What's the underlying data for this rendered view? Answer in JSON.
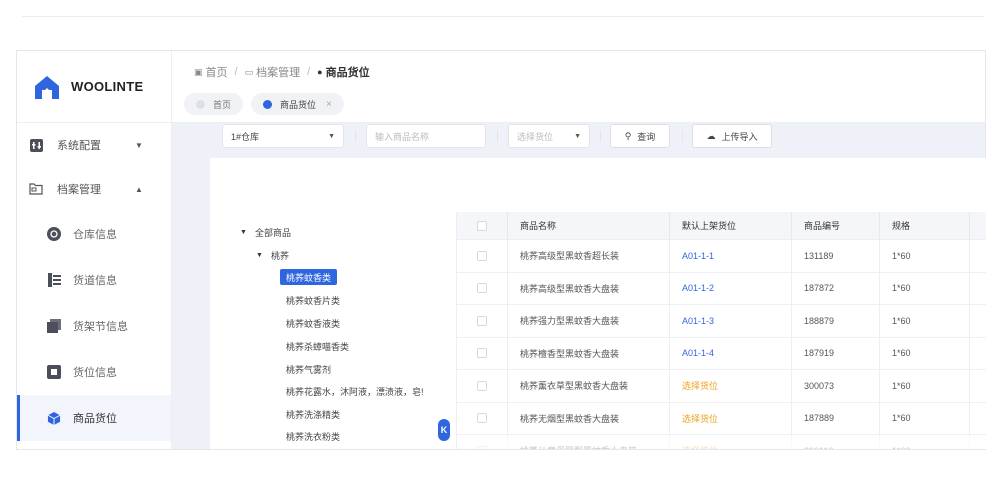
{
  "app": {
    "logo_text": "WOOLINTE",
    "brand_color": "#2f66e0",
    "warn_color": "#f0a020"
  },
  "sidebar": {
    "groups": [
      {
        "label": "系统配置",
        "icon": "settings-sliders-icon",
        "caret": "▼"
      },
      {
        "label": "档案管理",
        "icon": "folder-icon",
        "caret": "▲"
      }
    ],
    "items": [
      {
        "label": "仓库信息",
        "icon": "warehouse-icon"
      },
      {
        "label": "货道信息",
        "icon": "aisle-icon"
      },
      {
        "label": "货架节信息",
        "icon": "shelf-section-icon"
      },
      {
        "label": "货位信息",
        "icon": "slot-icon"
      },
      {
        "label": "商品货位",
        "icon": "cube-icon"
      }
    ]
  },
  "header": {
    "breadcrumb": [
      "首页",
      "档案管理",
      "商品货位"
    ],
    "tabs": [
      {
        "label": "首页"
      },
      {
        "label": "商品货位",
        "close": "×"
      }
    ]
  },
  "toolbar": {
    "warehouse_select": "1#仓库",
    "name_placeholder": "输入商品名称",
    "location_placeholder": "选择货位",
    "query_label": "查询",
    "upload_label": "上传导入"
  },
  "tree": {
    "root": "全部商品",
    "branch": "桃荞",
    "leaves": [
      "桃荞蚊香类",
      "桃荞蚊香片类",
      "桃荞蚊香液类",
      "桃荞杀蟑喵香类",
      "桃荞气雾剂",
      "桃荞花露水，沐阿液，漂渍液，皂!",
      "桃荞洗涤精类",
      "桃荞洗衣粉类"
    ],
    "collapse_label": "K"
  },
  "table": {
    "columns": [
      "商品名称",
      "默认上架货位",
      "商品编号",
      "规格"
    ],
    "rows": [
      {
        "name": "桃荞高级型黑蚊香超长装",
        "loc": "A01-1-1",
        "code": "131189",
        "spec": "1*60",
        "loc_type": "link"
      },
      {
        "name": "桃荞高级型黑蚊香大盘装",
        "loc": "A01-1-2",
        "code": "187872",
        "spec": "1*60",
        "loc_type": "link"
      },
      {
        "name": "桃荞强力型黑蚊香大盘装",
        "loc": "A01-1-3",
        "code": "188879",
        "spec": "1*60",
        "loc_type": "link"
      },
      {
        "name": "桃荞檀香型黑蚊香大盘装",
        "loc": "A01-1-4",
        "code": "187919",
        "spec": "1*60",
        "loc_type": "link"
      },
      {
        "name": "桃荞薰衣草型黑蚊香大盘装",
        "loc": "选择货位",
        "code": "300073",
        "spec": "1*60",
        "loc_type": "warn"
      },
      {
        "name": "桃荞无烟型黑蚊香大盘装",
        "loc": "选择货位",
        "code": "187889",
        "spec": "1*60",
        "loc_type": "warn"
      },
      {
        "name": "桃荞儿童母婴型黑蚊香大盘装",
        "loc": "选择货位",
        "code": "300110",
        "spec": "1*60",
        "loc_type": "warn"
      }
    ]
  }
}
